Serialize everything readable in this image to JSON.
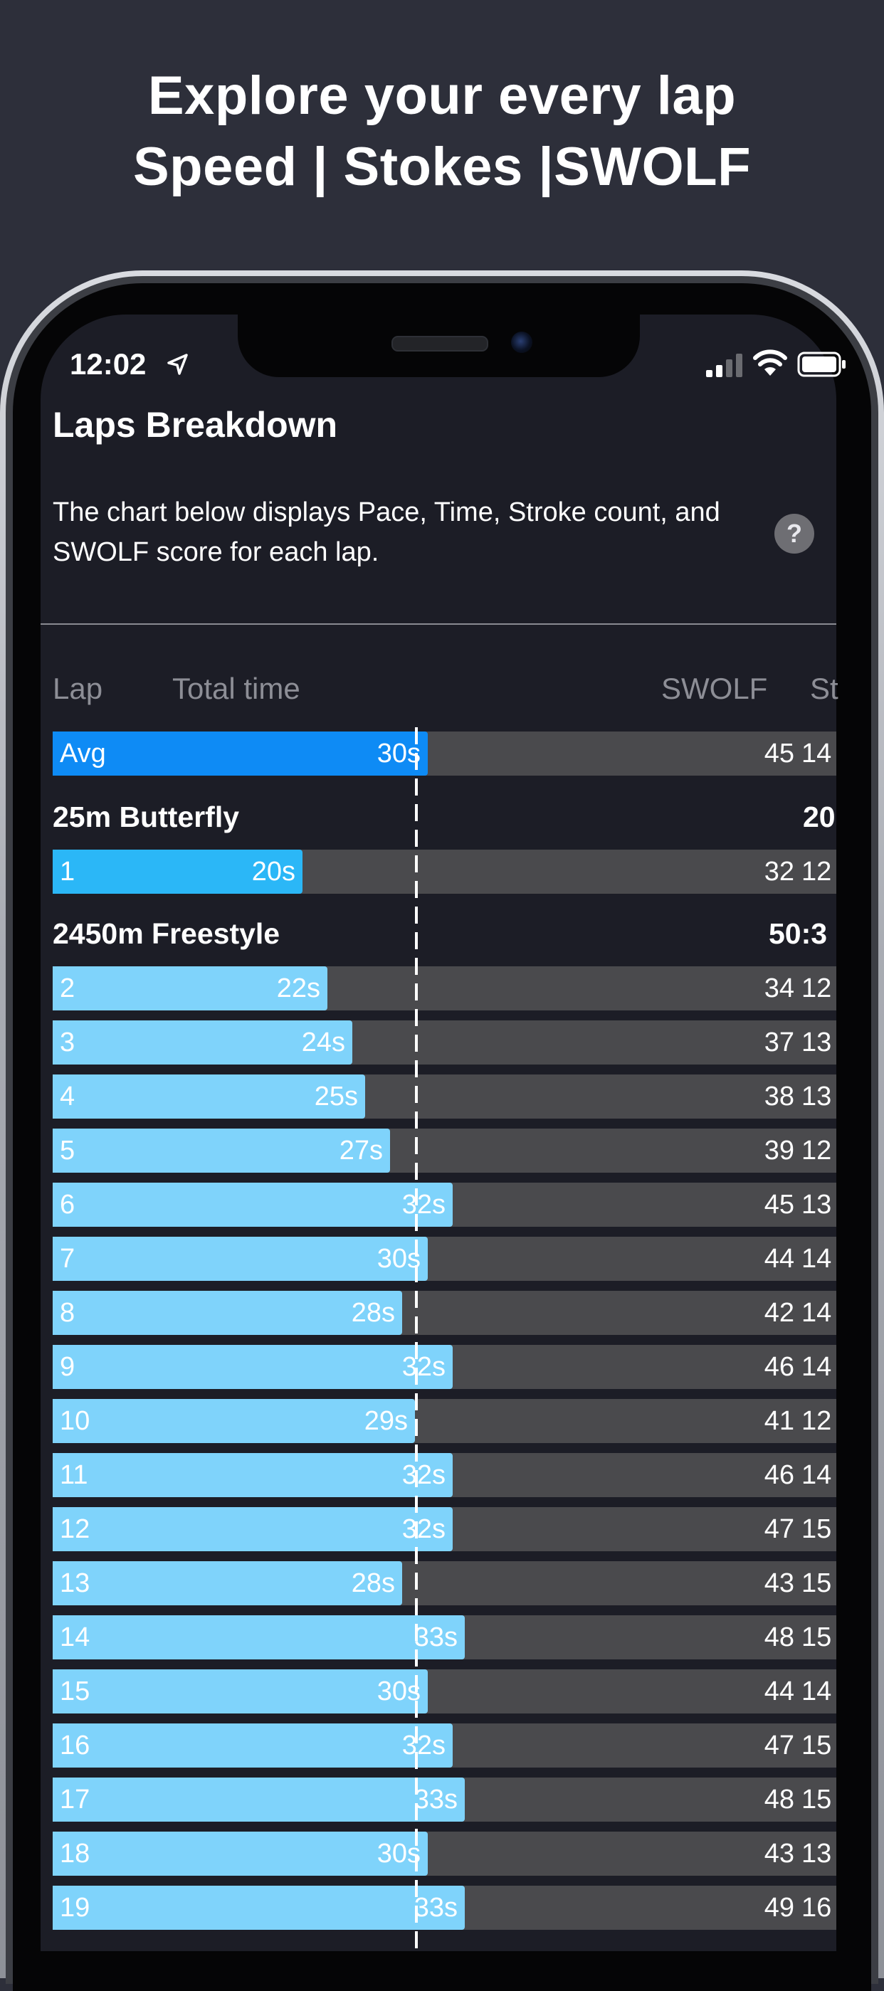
{
  "promo": {
    "line1": "Explore your every lap",
    "line2": "Speed | Stokes |SWOLF"
  },
  "status_bar": {
    "time": "12:02",
    "icons": [
      "location-arrow-icon",
      "signal-icon",
      "wifi-icon",
      "battery-icon"
    ]
  },
  "screen": {
    "title": "Laps Breakdown",
    "description": "The chart below displays Pace, Time, Stroke count, and SWOLF score for each lap.",
    "help_label": "?"
  },
  "columns": {
    "lap": "Lap",
    "total_time": "Total time",
    "swolf": "SWOLF",
    "strokes": "St"
  },
  "colors": {
    "avg_bar": "#0e8bf5",
    "butterfly_bar": "#2bb7f7",
    "freestyle_bar": "#7fd3fb",
    "track": "#4a4a4d",
    "background": "#1c1d26"
  },
  "average": {
    "label": "Avg",
    "time": "30s",
    "seconds": 30,
    "swolf": "45",
    "strokes": "14"
  },
  "sections": [
    {
      "heading": "25m Butterfly",
      "total": "20",
      "laps": [
        {
          "lap": "1",
          "time": "20s",
          "seconds": 20,
          "swolf": "32",
          "strokes": "12"
        }
      ]
    },
    {
      "heading": "2450m Freestyle",
      "total": "50:3",
      "laps": [
        {
          "lap": "2",
          "time": "22s",
          "seconds": 22,
          "swolf": "34",
          "strokes": "12"
        },
        {
          "lap": "3",
          "time": "24s",
          "seconds": 24,
          "swolf": "37",
          "strokes": "13"
        },
        {
          "lap": "4",
          "time": "25s",
          "seconds": 25,
          "swolf": "38",
          "strokes": "13"
        },
        {
          "lap": "5",
          "time": "27s",
          "seconds": 27,
          "swolf": "39",
          "strokes": "12"
        },
        {
          "lap": "6",
          "time": "32s",
          "seconds": 32,
          "swolf": "45",
          "strokes": "13"
        },
        {
          "lap": "7",
          "time": "30s",
          "seconds": 30,
          "swolf": "44",
          "strokes": "14"
        },
        {
          "lap": "8",
          "time": "28s",
          "seconds": 28,
          "swolf": "42",
          "strokes": "14"
        },
        {
          "lap": "9",
          "time": "32s",
          "seconds": 32,
          "swolf": "46",
          "strokes": "14"
        },
        {
          "lap": "10",
          "time": "29s",
          "seconds": 29,
          "swolf": "41",
          "strokes": "12"
        },
        {
          "lap": "11",
          "time": "32s",
          "seconds": 32,
          "swolf": "46",
          "strokes": "14"
        },
        {
          "lap": "12",
          "time": "32s",
          "seconds": 32,
          "swolf": "47",
          "strokes": "15"
        },
        {
          "lap": "13",
          "time": "28s",
          "seconds": 28,
          "swolf": "43",
          "strokes": "15"
        },
        {
          "lap": "14",
          "time": "33s",
          "seconds": 33,
          "swolf": "48",
          "strokes": "15"
        },
        {
          "lap": "15",
          "time": "30s",
          "seconds": 30,
          "swolf": "44",
          "strokes": "14"
        },
        {
          "lap": "16",
          "time": "32s",
          "seconds": 32,
          "swolf": "47",
          "strokes": "15"
        },
        {
          "lap": "17",
          "time": "33s",
          "seconds": 33,
          "swolf": "48",
          "strokes": "15"
        },
        {
          "lap": "18",
          "time": "30s",
          "seconds": 30,
          "swolf": "43",
          "strokes": "13"
        },
        {
          "lap": "19",
          "time": "33s",
          "seconds": 33,
          "swolf": "49",
          "strokes": "16"
        }
      ]
    }
  ]
}
